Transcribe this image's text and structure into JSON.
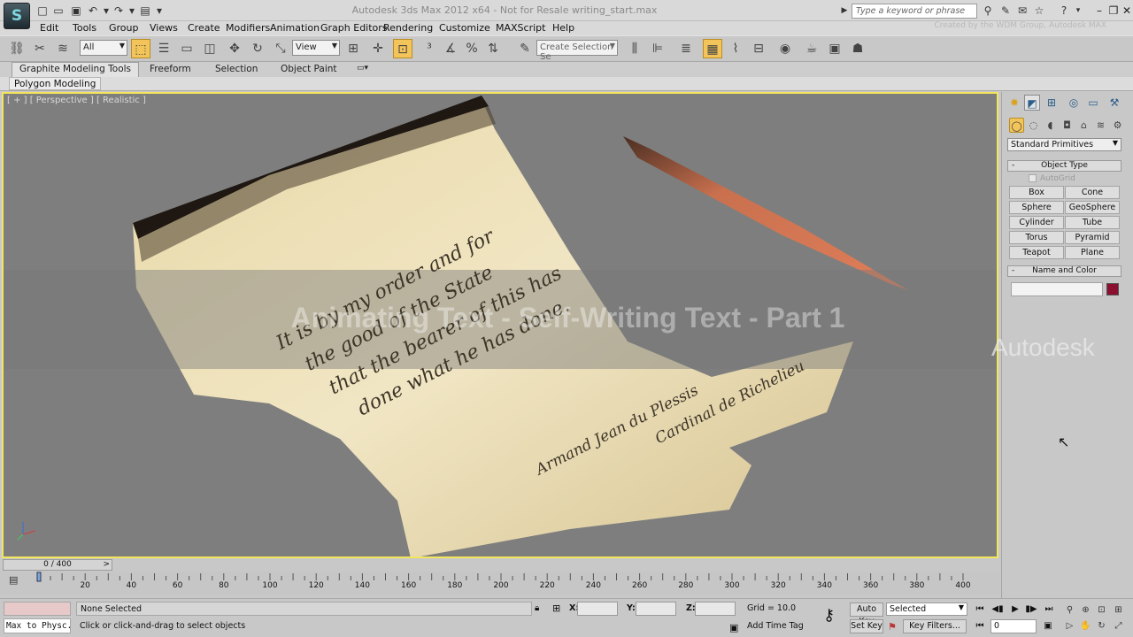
{
  "window": {
    "title": "Autodesk 3ds Max 2012 x64    - Not for Resale    writing_start.max",
    "search_placeholder": "Type a keyword or phrase",
    "credit": "Created by the WDM Group, Autodesk MAX",
    "app_logo_glyph": "S"
  },
  "menu": [
    "Edit",
    "Tools",
    "Group",
    "Views",
    "Create",
    "Modifiers",
    "Animation",
    "Graph Editors",
    "Rendering",
    "Customize",
    "MAXScript",
    "Help"
  ],
  "toolbar": {
    "selection_filter": "All",
    "reference_coord": "View",
    "named_selection_placeholder": "Create Selection Se"
  },
  "ribbon": {
    "tabs": [
      "Graphite Modeling Tools",
      "Freeform",
      "Selection",
      "Object Paint"
    ],
    "active_tab": "Graphite Modeling Tools",
    "panel_label": "Polygon Modeling"
  },
  "viewport": {
    "label": "[ + ] [ Perspective ] [ Realistic ]",
    "overlay_title": "Animating Text - Self-Writing Text - Part 1",
    "brand": "Autodesk",
    "scroll_text": {
      "lines": [
        "It is by my order and for",
        "the good of the State",
        "that the bearer of this has",
        "done what he has done."
      ],
      "signature": [
        "Armand Jean du Plessis",
        "Cardinal de Richelieu"
      ]
    }
  },
  "command_panel": {
    "category_dropdown": "Standard Primitives",
    "object_type_title": "Object Type",
    "autogrid_label": "AutoGrid",
    "primitives": [
      "Box",
      "Cone",
      "Sphere",
      "GeoSphere",
      "Cylinder",
      "Tube",
      "Torus",
      "Pyramid",
      "Teapot",
      "Plane"
    ],
    "name_color_title": "Name and Color",
    "object_color": "#8b1030"
  },
  "timeline": {
    "slider_label": "0 / 400",
    "tick_labels": [
      "20",
      "40",
      "60",
      "80",
      "100",
      "120",
      "140",
      "160",
      "180",
      "200",
      "220",
      "240",
      "260",
      "280",
      "300",
      "320",
      "340",
      "360",
      "380",
      "400"
    ]
  },
  "status": {
    "script_listener": "Max to Physc.",
    "selection": "None Selected",
    "prompt": "Click or click-and-drag to select objects",
    "x_label": "X:",
    "y_label": "Y:",
    "z_label": "Z:",
    "grid": "Grid = 10.0",
    "add_time_tag": "Add Time Tag",
    "auto_key": "Auto Key",
    "set_key": "Set Key",
    "key_mode": "Selected",
    "key_filters": "Key Filters...",
    "current_frame": "0"
  }
}
